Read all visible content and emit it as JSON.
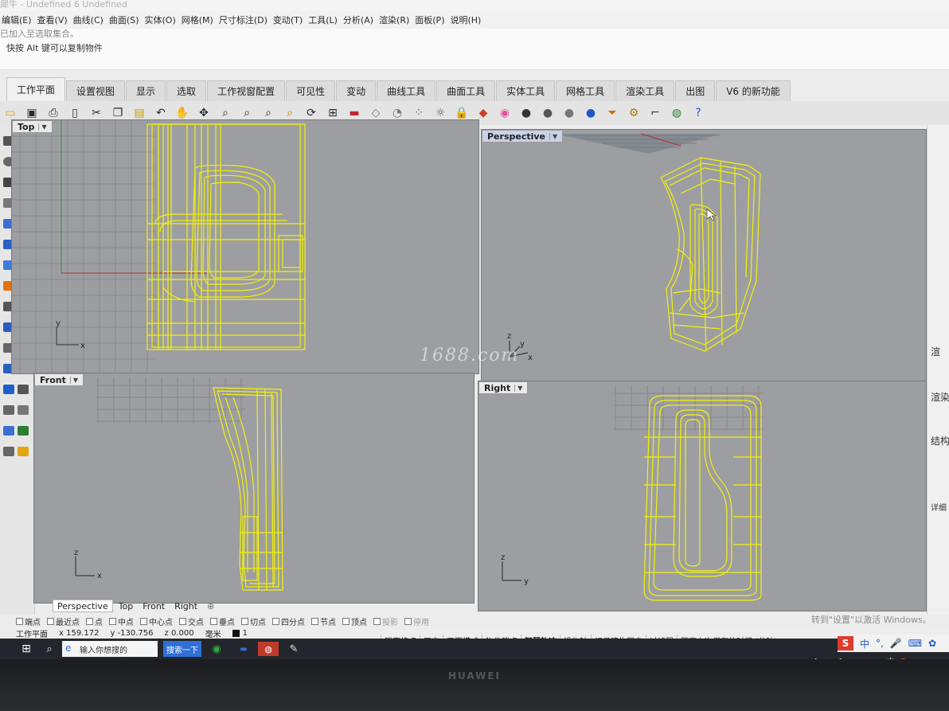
{
  "app": {
    "title": "犀牛 - Undefined 6 Undefined",
    "menu": [
      "编辑(E)",
      "查看(V)",
      "曲线(C)",
      "曲面(S)",
      "实体(O)",
      "网格(M)",
      "尺寸标注(D)",
      "变动(T)",
      "工具(L)",
      "分析(A)",
      "渲染(R)",
      "面板(P)",
      "说明(H)"
    ]
  },
  "command": {
    "history_line": "已加入至选取集合。",
    "prompt": "快按 Alt 键可以复制物件"
  },
  "tabs": [
    {
      "label": "工作平面",
      "active": true
    },
    {
      "label": "设置视图"
    },
    {
      "label": "显示"
    },
    {
      "label": "选取"
    },
    {
      "label": "工作视窗配置"
    },
    {
      "label": "可见性"
    },
    {
      "label": "变动"
    },
    {
      "label": "曲线工具"
    },
    {
      "label": "曲面工具"
    },
    {
      "label": "实体工具"
    },
    {
      "label": "网格工具"
    },
    {
      "label": "渲染工具"
    },
    {
      "label": "出图"
    },
    {
      "label": "V6 的新功能"
    }
  ],
  "toolbar_icons": [
    {
      "name": "new-file-icon",
      "glyph": "▭",
      "color": "#d9a400"
    },
    {
      "name": "save-icon",
      "glyph": "▣",
      "color": "#2a2a2a"
    },
    {
      "name": "print-icon",
      "glyph": "⎙",
      "color": "#2a2a2a"
    },
    {
      "name": "page-icon",
      "glyph": "▯",
      "color": "#2a2a2a"
    },
    {
      "name": "cut-icon",
      "glyph": "✂",
      "color": "#2a2a2a"
    },
    {
      "name": "copy-icon",
      "glyph": "❐",
      "color": "#2a2a2a"
    },
    {
      "name": "paste-icon",
      "glyph": "▤",
      "color": "#c89b00"
    },
    {
      "name": "undo-icon",
      "glyph": "↶",
      "color": "#2a2a2a"
    },
    {
      "name": "pan-hand-icon",
      "glyph": "✋",
      "color": "#2a2a2a"
    },
    {
      "name": "move-icon",
      "glyph": "✥",
      "color": "#2a2a2a"
    },
    {
      "name": "zoom-icon",
      "glyph": "⌕",
      "color": "#2a2a2a"
    },
    {
      "name": "zoom-window-icon",
      "glyph": "⌕",
      "color": "#2a2a2a"
    },
    {
      "name": "zoom-extents-icon",
      "glyph": "⌕",
      "color": "#2a2a2a"
    },
    {
      "name": "zoom-selected-icon",
      "glyph": "⌕",
      "color": "#b58b00"
    },
    {
      "name": "rotate-view-icon",
      "glyph": "⟳",
      "color": "#2a2a2a"
    },
    {
      "name": "viewport-layout-icon",
      "glyph": "⊞",
      "color": "#2a2a2a"
    },
    {
      "name": "car-icon",
      "glyph": "▬",
      "color": "#c0262c"
    },
    {
      "name": "eraser-icon",
      "glyph": "◇",
      "color": "#777777"
    },
    {
      "name": "clock-icon",
      "glyph": "◔",
      "color": "#777777"
    },
    {
      "name": "points-icon",
      "glyph": "⁘",
      "color": "#555555"
    },
    {
      "name": "light-icon",
      "glyph": "☼",
      "color": "#555555"
    },
    {
      "name": "lock-icon",
      "glyph": "🔒",
      "color": "#555555"
    },
    {
      "name": "layer-icon",
      "glyph": "◆",
      "color": "#d23c2b"
    },
    {
      "name": "color-wheel-icon",
      "glyph": "◉",
      "color": "#e04fa0"
    },
    {
      "name": "shaded-sphere-icon",
      "glyph": "●",
      "color": "#333333"
    },
    {
      "name": "render-sphere-icon",
      "glyph": "●",
      "color": "#555555"
    },
    {
      "name": "gloss-sphere-icon",
      "glyph": "●",
      "color": "#777777"
    },
    {
      "name": "blue-sphere-icon",
      "glyph": "●",
      "color": "#1f57c6"
    },
    {
      "name": "filter-icon",
      "glyph": "⏷",
      "color": "#d46a00"
    },
    {
      "name": "gear-icon",
      "glyph": "⚙",
      "color": "#b57b00"
    },
    {
      "name": "dimension-icon",
      "glyph": "⌐",
      "color": "#333333"
    },
    {
      "name": "globe-icon",
      "glyph": "◍",
      "color": "#2e7d32"
    },
    {
      "name": "help-icon",
      "glyph": "?",
      "color": "#1f57c6"
    }
  ],
  "viewports": {
    "top": {
      "label": "Top",
      "axis_x": "x",
      "axis_y": "y"
    },
    "perspective": {
      "label": "Perspective",
      "axis_x": "x",
      "axis_y": "y",
      "axis_z": "z"
    },
    "front": {
      "label": "Front",
      "axis_x": "x",
      "axis_y": "z"
    },
    "right": {
      "label": "Right",
      "axis_x": "y",
      "axis_y": "z"
    }
  },
  "watermark": "1688.com",
  "right_panel": [
    "渲",
    "渲染",
    "结构",
    "详细"
  ],
  "viewport_tabs": [
    {
      "label": "Perspective",
      "active": true
    },
    {
      "label": "Top"
    },
    {
      "label": "Front"
    },
    {
      "label": "Right"
    }
  ],
  "osnaps": [
    {
      "label": "端点"
    },
    {
      "label": "最近点"
    },
    {
      "label": "点"
    },
    {
      "label": "中点"
    },
    {
      "label": "中心点"
    },
    {
      "label": "交点"
    },
    {
      "label": "垂点"
    },
    {
      "label": "切点"
    },
    {
      "label": "四分点"
    },
    {
      "label": "节点"
    },
    {
      "label": "顶点"
    },
    {
      "label": "投影",
      "disabled": true
    },
    {
      "label": "停用",
      "disabled": true
    }
  ],
  "activation_text": "转到\"设置\"以激活 Windows。",
  "status": {
    "cplane": "工作平面",
    "x": "x 159.172",
    "y": "y -130.756",
    "z": "z 0.000",
    "unit": "毫米",
    "layer": "1",
    "items": [
      "锁定格点",
      "正交",
      "平面模式",
      "物件锁点",
      "智慧轨迹",
      "操作轴",
      "记录建构历史",
      "过滤器",
      "距离上次保存的时间 (分钟): 9"
    ]
  },
  "taskbar": {
    "search_placeholder": "输入你想搜的",
    "search_button": "搜索一下"
  },
  "ime": {
    "label": "中"
  },
  "tray_lang": "中",
  "brand": "HUAWEI",
  "colors": {
    "wireframe": "#f2f20a",
    "viewport_bg": "#9d9ea2",
    "active_label": "#c7d3e6",
    "taskbar": "#23272d"
  }
}
